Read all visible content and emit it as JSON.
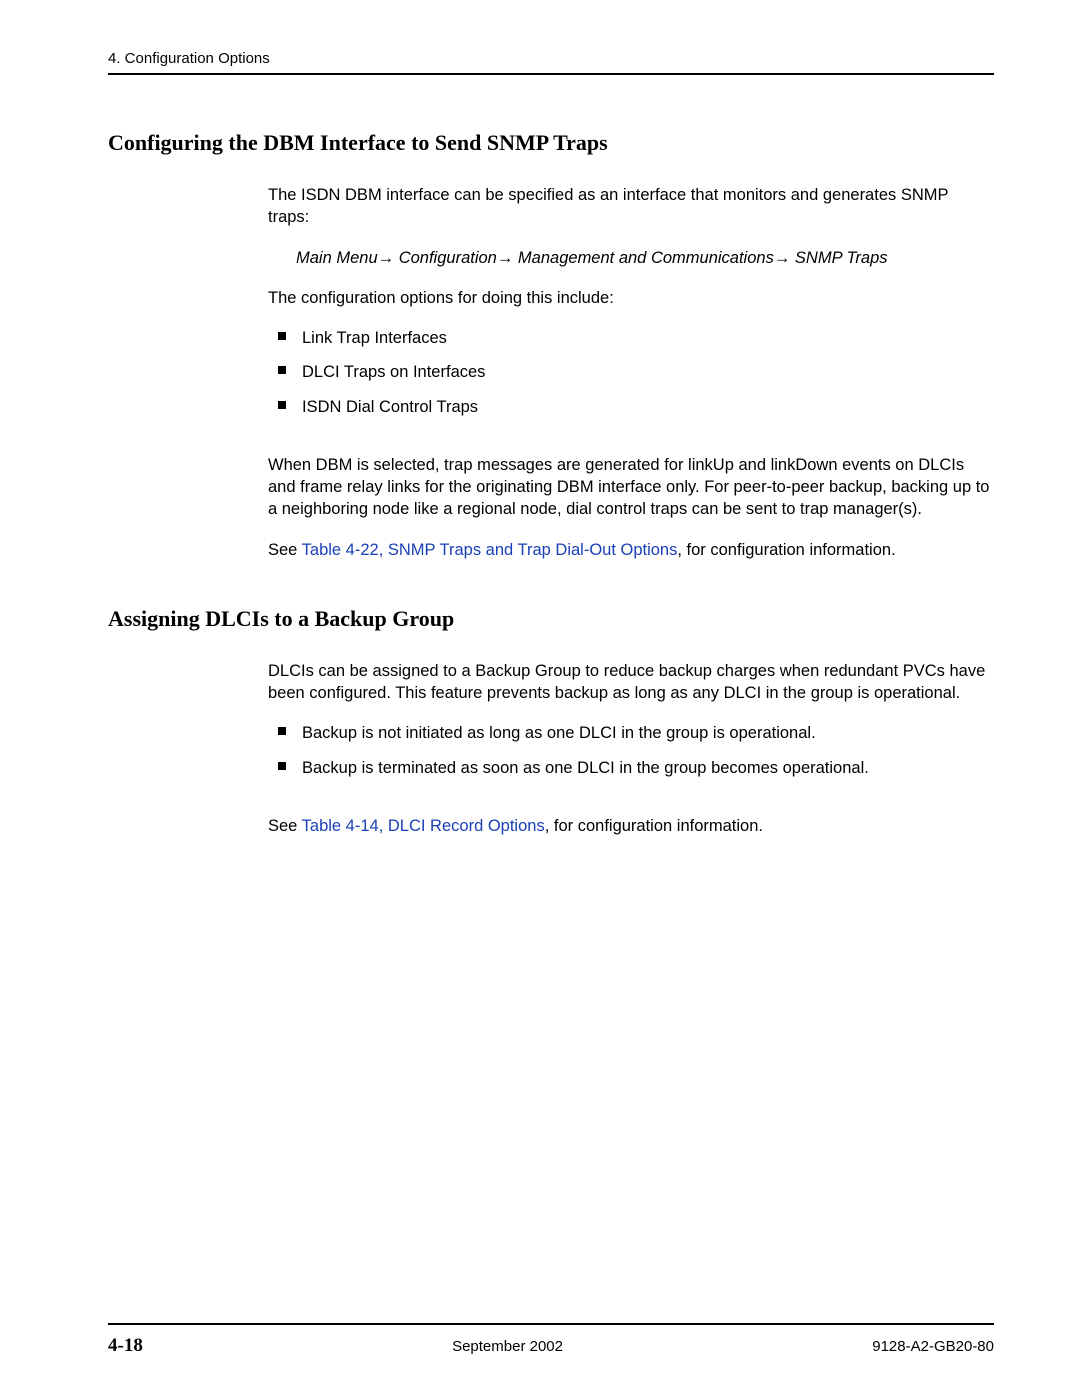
{
  "header": {
    "left": "4. Configuration Options"
  },
  "section1": {
    "heading": "Configuring the DBM Interface to Send SNMP Traps",
    "intro": "The ISDN DBM interface can be specified as an interface that monitors and generates SNMP traps:",
    "navpath": "Main Menu→ Configuration→ Management and Communications→ SNMP Traps",
    "options_intro": "The configuration options for doing this include:",
    "options": [
      "Link Trap Interfaces",
      "DLCI Traps on Interfaces",
      "ISDN Dial Control Traps"
    ],
    "para1": "When DBM is selected, trap messages are generated for linkUp and linkDown events on DLCIs and frame relay links for the originating DBM interface only. For peer-to-peer backup, backing up to a neighboring node like a regional node, dial control traps can be sent to trap manager(s).",
    "see_prefix": "See ",
    "see_link": "Table 4-22, SNMP Traps and Trap Dial-Out Options",
    "see_suffix": ", for configuration information."
  },
  "section2": {
    "heading": "Assigning DLCIs to a Backup Group",
    "intro": "DLCIs can be assigned to a Backup Group to reduce backup charges when redundant PVCs have been configured. This feature prevents backup as long as any DLCI in the group is operational.",
    "bullets": [
      "Backup is not initiated as long as one DLCI in the group is operational.",
      "Backup is terminated as soon as one DLCI in the group becomes operational."
    ],
    "see_prefix": "See ",
    "see_link": "Table 4-14, DLCI Record Options",
    "see_suffix": ", for configuration information."
  },
  "footer": {
    "page": "4-18",
    "date": "September 2002",
    "docid": "9128-A2-GB20-80"
  }
}
